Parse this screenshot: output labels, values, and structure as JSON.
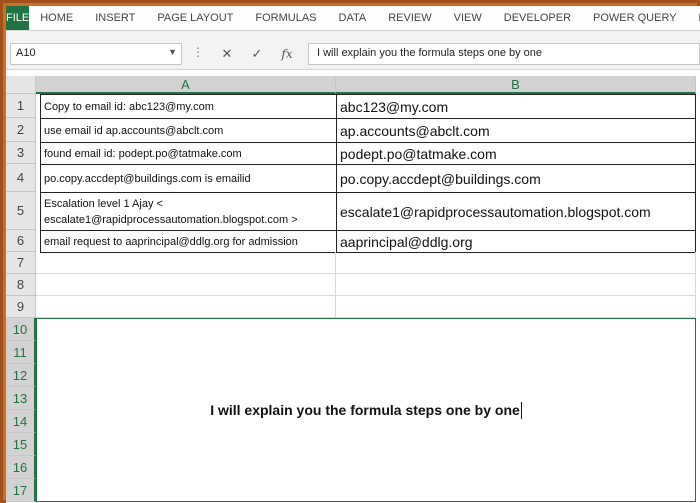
{
  "ribbon": {
    "file": "FILE",
    "tabs": [
      "HOME",
      "INSERT",
      "PAGE LAYOUT",
      "FORMULAS",
      "DATA",
      "REVIEW",
      "VIEW",
      "DEVELOPER",
      "POWER QUERY",
      "POWE"
    ]
  },
  "formula_bar": {
    "name_box": "A10",
    "cancel_icon": "✕",
    "enter_icon": "✓",
    "fx_icon": "fx",
    "content": "I will explain you the formula steps one by one"
  },
  "columns": [
    "A",
    "B"
  ],
  "rows": [
    {
      "num": "1",
      "a": "Copy to email id: abc123@my.com",
      "b": "abc123@my.com"
    },
    {
      "num": "2",
      "a": "use email id ap.accounts@abclt.com",
      "b": "ap.accounts@abclt.com"
    },
    {
      "num": "3",
      "a": "found email id: podept.po@tatmake.com",
      "b": "podept.po@tatmake.com"
    },
    {
      "num": "4",
      "a": "po.copy.accdept@buildings.com is emailid",
      "b": "po.copy.accdept@buildings.com"
    },
    {
      "num": "5",
      "a": "Escalation level 1 Ajay  < escalate1@rapidprocessautomation.blogspot.com >",
      "b": "escalate1@rapidprocessautomation.blogspot.com"
    },
    {
      "num": "6",
      "a": "email request to aaprincipal@ddlg.org for admission",
      "b": "aaprincipal@ddlg.org"
    }
  ],
  "empty_rows": [
    "7",
    "8",
    "9"
  ],
  "selected_rows": [
    "10",
    "11",
    "12",
    "13",
    "14",
    "15",
    "16",
    "17"
  ],
  "merged_text": "I will explain you the formula steps one by one"
}
